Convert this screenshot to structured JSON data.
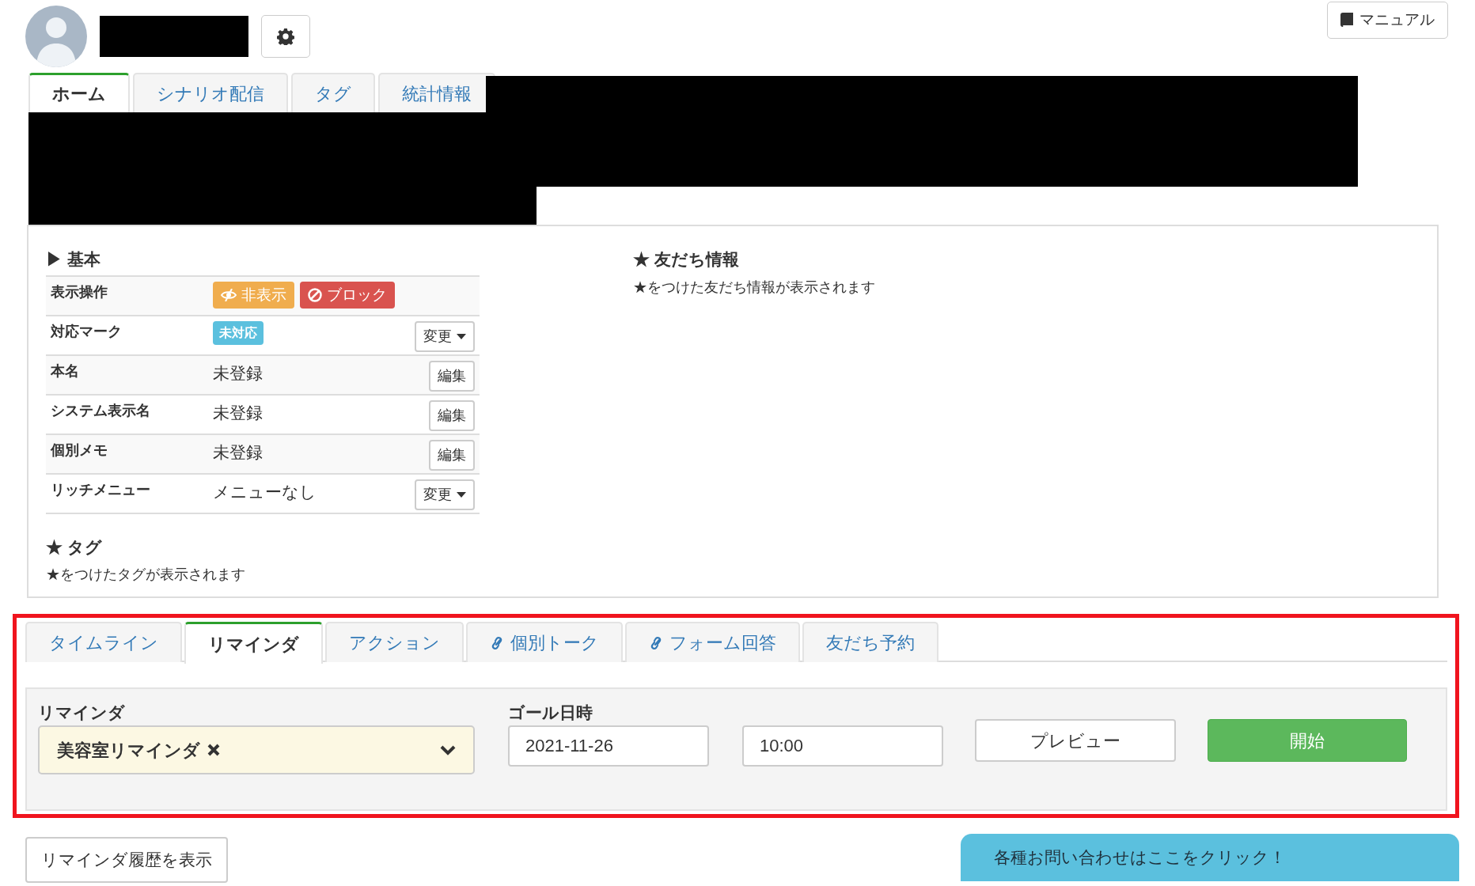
{
  "header": {
    "manual_button": "マニュアル"
  },
  "main_tabs": [
    {
      "label": "ホーム",
      "selected": true
    },
    {
      "label": "シナリオ配信",
      "selected": false
    },
    {
      "label": "タグ",
      "selected": false
    },
    {
      "label": "統計情報",
      "selected": false
    }
  ],
  "basic": {
    "title": "▶ 基本",
    "rows": [
      {
        "label": "表示操作",
        "kind": "actions",
        "actions": [
          {
            "label": "非表示",
            "kind": "hide",
            "color": "#f0ad4e"
          },
          {
            "label": "ブロック",
            "kind": "block",
            "color": "#d9534f"
          }
        ]
      },
      {
        "label": "対応マーク",
        "kind": "badge",
        "badge": "未対応",
        "button": "変更",
        "dropdown": true
      },
      {
        "label": "本名",
        "kind": "text",
        "value": "未登録",
        "button": "編集",
        "dropdown": false
      },
      {
        "label": "システム表示名",
        "kind": "text",
        "value": "未登録",
        "button": "編集",
        "dropdown": false
      },
      {
        "label": "個別メモ",
        "kind": "text",
        "value": "未登録",
        "button": "編集",
        "dropdown": false
      },
      {
        "label": "リッチメニュー",
        "kind": "text",
        "value": "メニューなし",
        "button": "変更",
        "dropdown": true
      }
    ]
  },
  "tags": {
    "title": "★ タグ",
    "note": "★をつけたタグが表示されます"
  },
  "friend_info": {
    "title": "★ 友だち情報",
    "note": "★をつけた友だち情報が表示されます"
  },
  "sub_tabs": [
    {
      "label": "タイムライン",
      "kind": "plain",
      "selected": false
    },
    {
      "label": "リマインダ",
      "kind": "plain",
      "selected": true
    },
    {
      "label": "アクション",
      "kind": "plain",
      "selected": false
    },
    {
      "label": "個別トーク",
      "kind": "link",
      "selected": false
    },
    {
      "label": "フォーム回答",
      "kind": "link",
      "selected": false
    },
    {
      "label": "友だち予約",
      "kind": "plain",
      "selected": false
    }
  ],
  "reminder_form": {
    "reminder_label": "リマインダ",
    "reminder_value": "美容室リマインダ",
    "goal_label": "ゴール日時",
    "date": "2021-11-26",
    "time": "10:00",
    "preview_button": "プレビュー",
    "start_button": "開始"
  },
  "history_button": "リマインダ履歴を表示",
  "contact_tab": "各種お問い合わせはここをクリック！"
}
